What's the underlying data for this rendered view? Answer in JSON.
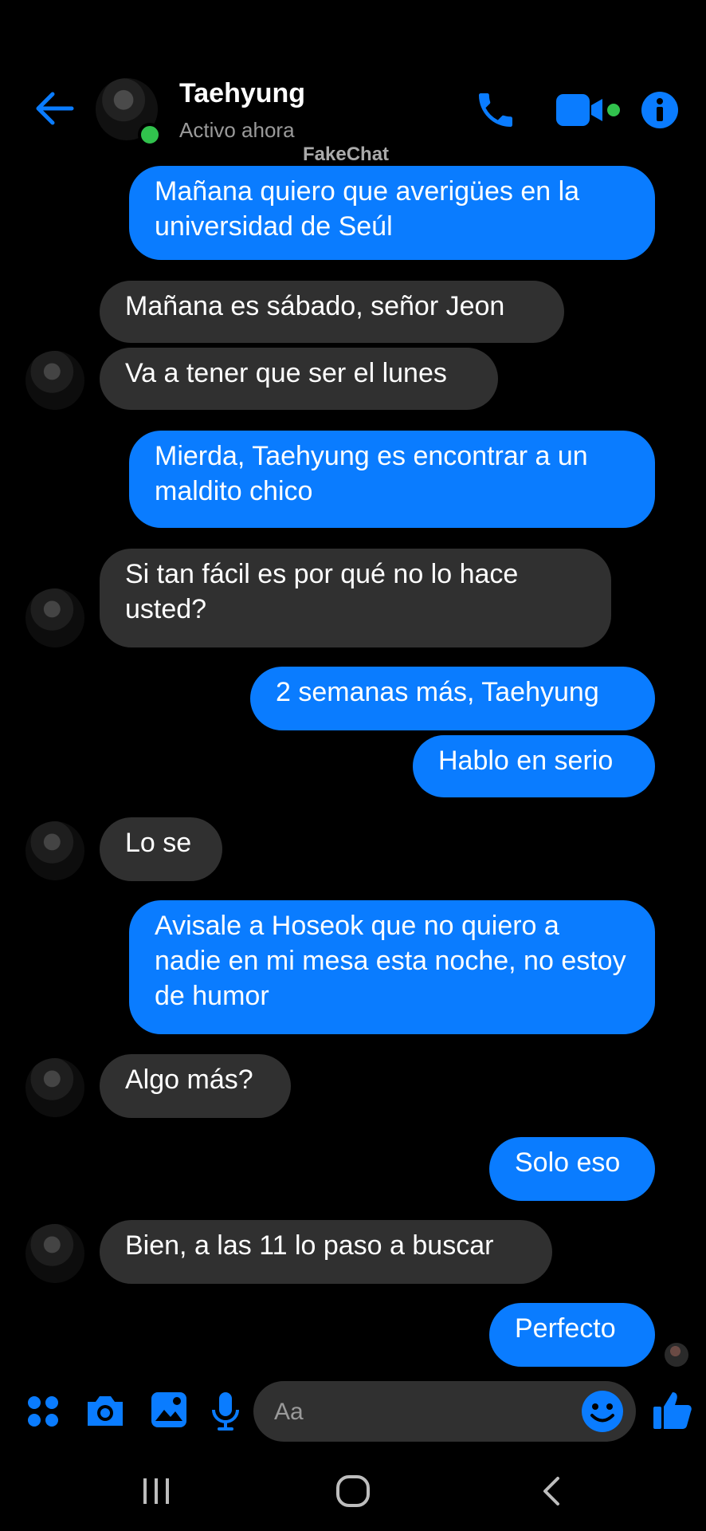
{
  "header": {
    "name": "Taehyung",
    "status": "Activo ahora",
    "watermark": "FakeChat",
    "icons": [
      "back-arrow-icon",
      "phone-icon",
      "video-camera-icon",
      "info-icon"
    ],
    "accent": "#0a7cff"
  },
  "messages": [
    {
      "dir": "out",
      "text": "Mañana quiero que averigües en la universidad de Seúl"
    },
    {
      "dir": "in",
      "text": "Mañana es sábado, señor Jeon"
    },
    {
      "dir": "in",
      "text": "Va a tener que ser el lunes"
    },
    {
      "dir": "out",
      "text": "Mierda, Taehyung es encontrar a un maldito chico"
    },
    {
      "dir": "in",
      "text": "Si tan fácil es por qué no lo hace usted?"
    },
    {
      "dir": "out",
      "text": "2 semanas más, Taehyung"
    },
    {
      "dir": "out",
      "text": "Hablo en serio"
    },
    {
      "dir": "in",
      "text": "Lo se"
    },
    {
      "dir": "out",
      "text": "Avisale a Hoseok que no quiero a nadie en mi mesa esta noche, no estoy de humor"
    },
    {
      "dir": "in",
      "text": "Algo más?"
    },
    {
      "dir": "out",
      "text": "Solo eso"
    },
    {
      "dir": "in",
      "text": "Bien, a las 11 lo paso a buscar"
    },
    {
      "dir": "out",
      "text": "Perfecto"
    }
  ],
  "composer": {
    "placeholder": "Aa",
    "icons": [
      "apps-grid-icon",
      "camera-icon",
      "gallery-icon",
      "microphone-icon",
      "emoji-icon",
      "thumbs-up-icon"
    ]
  },
  "navbar": {
    "icons": [
      "recent-apps-icon",
      "home-icon",
      "back-icon"
    ]
  }
}
